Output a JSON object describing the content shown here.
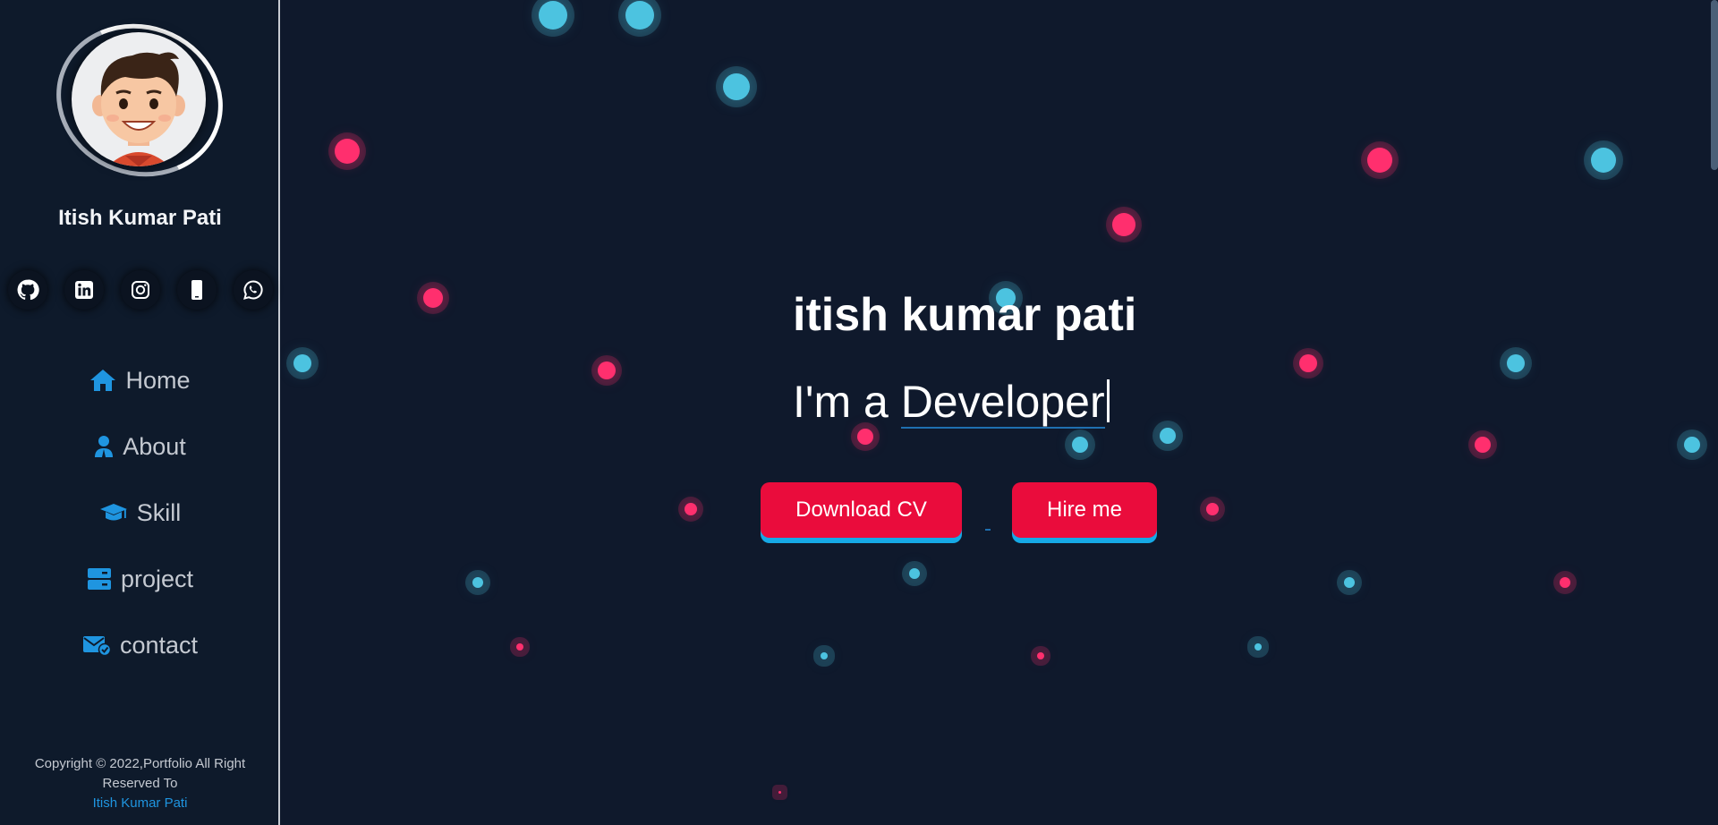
{
  "sidebar": {
    "name": "Itish Kumar Pati",
    "socials": [
      {
        "icon": "github-icon"
      },
      {
        "icon": "linkedin-icon"
      },
      {
        "icon": "instagram-icon"
      },
      {
        "icon": "phone-icon"
      },
      {
        "icon": "whatsapp-icon"
      }
    ],
    "nav": [
      {
        "label": "Home",
        "icon": "home-icon"
      },
      {
        "label": "About",
        "icon": "user-icon"
      },
      {
        "label": "Skill",
        "icon": "graduation-cap-icon"
      },
      {
        "label": "project",
        "icon": "server-icon"
      },
      {
        "label": "contact",
        "icon": "mail-check-icon"
      }
    ],
    "footer": {
      "line1": "Copyright © 2022,Portfolio All Right",
      "line2": "Reserved To",
      "link": "Itish Kumar Pati"
    }
  },
  "hero": {
    "title": "itish kumar pati",
    "prefix": "I'm a ",
    "typed": "Developer",
    "buttons": {
      "download_cv": "Download CV",
      "hire_me": "Hire me"
    }
  },
  "colors": {
    "background": "#0f192c",
    "accent_pink": "#ea0c3c",
    "accent_blue": "#16a9e6",
    "dot_cyan": "#4cc3e0",
    "dot_pink": "#ff2f6e"
  }
}
